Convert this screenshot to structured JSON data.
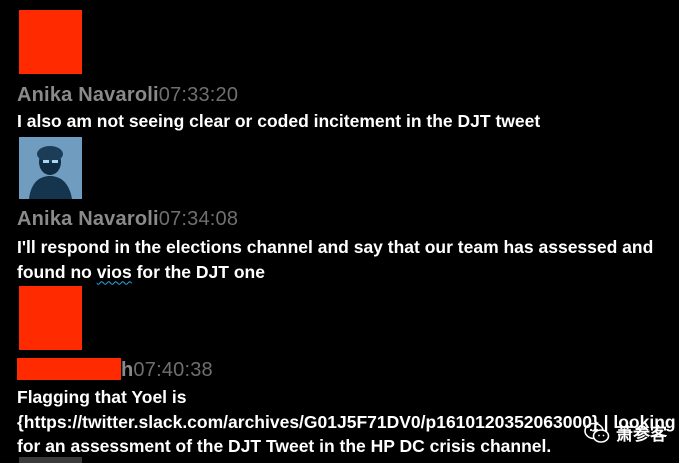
{
  "messages": [
    {
      "author": "Anika Navaroli",
      "time": "07:33:20",
      "text": "I also am not seeing clear or coded incitement in the DJT tweet"
    },
    {
      "author": "Anika Navaroli",
      "time": "07:34:08",
      "text_parts": [
        "I'll respond in the elections channel and say that our team has assessed and found no ",
        "vios",
        " for the DJT one"
      ]
    },
    {
      "author_suffix": "h",
      "time": "07:40:38",
      "text": "Flagging that Yoel is {https://twitter.slack.com/archives/G01J5F71DV0/p1610120352063000} | looking for an assessment of the DJT Tweet in the HP DC crisis channel."
    }
  ],
  "watermark": {
    "label": "萧参客"
  },
  "colors": {
    "background": "#000000",
    "redaction": "#ff2a00",
    "author": "#8a8a8a",
    "time": "#6f6f6f",
    "text": "#ffffff"
  }
}
